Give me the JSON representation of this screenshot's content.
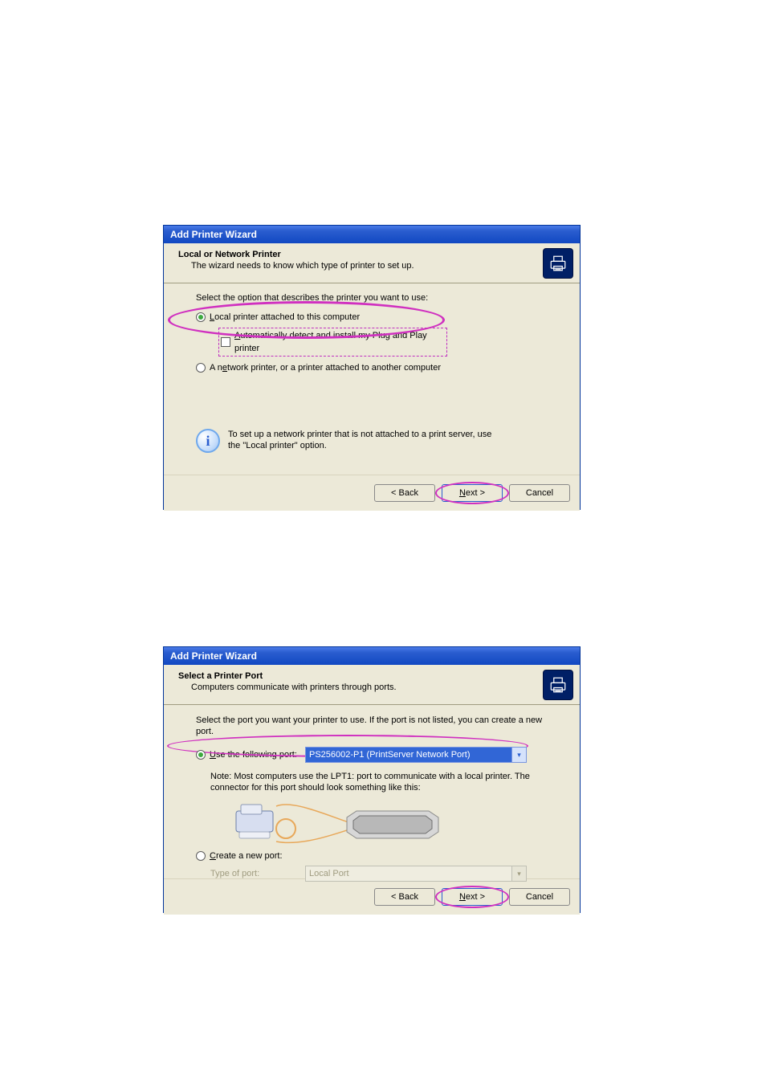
{
  "dlg1": {
    "title": "Add Printer Wizard",
    "header_title": "Local or Network Printer",
    "header_sub": "The wizard needs to know which type of printer to set up.",
    "prompt": "Select the option that describes the printer you want to use:",
    "opt1": "Local printer attached to this computer",
    "opt1_chk": "Automatically detect and install my Plug and Play printer",
    "opt2": "A network printer, or a printer attached to another computer",
    "info": "To set up a network printer that is not attached to a print server, use the \"Local printer\" option.",
    "back": "< Back",
    "next": "Next >",
    "cancel": "Cancel"
  },
  "dlg2": {
    "title": "Add Printer Wizard",
    "header_title": "Select a Printer Port",
    "header_sub": "Computers communicate with printers through ports.",
    "prompt": "Select the port you want your printer to use.  If the port is not listed, you can create a new port.",
    "opt1": "Use the following port:",
    "port_value": "PS256002-P1 (PrintServer Network Port)",
    "note": "Note: Most computers use the LPT1: port to communicate with a local printer. The connector for this port should look something like this:",
    "opt2": "Create a new port:",
    "type_label": "Type of port:",
    "type_value": "Local Port",
    "back": "< Back",
    "next": "Next >",
    "cancel": "Cancel"
  }
}
